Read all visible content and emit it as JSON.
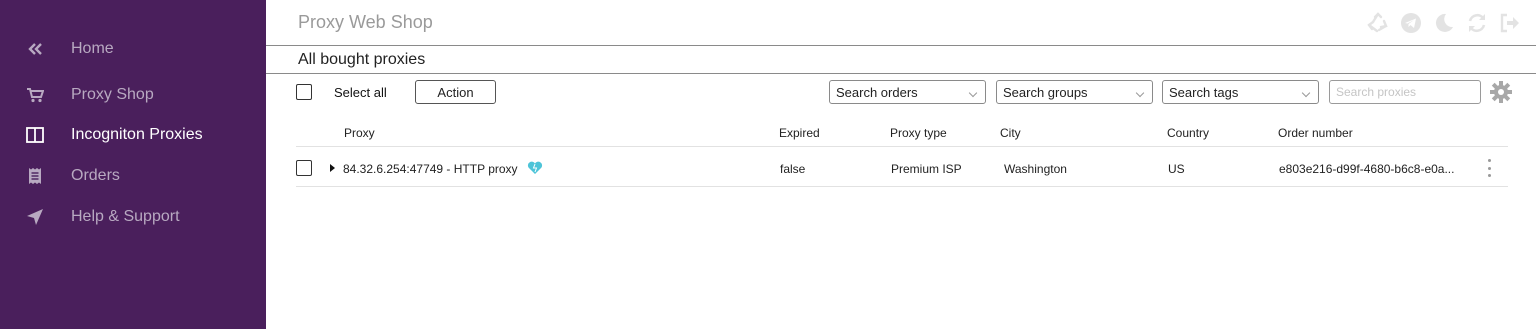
{
  "app": {
    "title": "Proxy Web Shop"
  },
  "sidebar": {
    "items": [
      {
        "label": "Home",
        "icon": "double-chevron-left-icon"
      },
      {
        "label": "Proxy Shop",
        "icon": "cart-icon"
      },
      {
        "label": "Incogniton Proxies",
        "icon": "columns-icon",
        "active": true
      },
      {
        "label": "Orders",
        "icon": "receipt-icon"
      },
      {
        "label": "Help & Support",
        "icon": "paper-plane-icon"
      }
    ]
  },
  "topbar": {
    "icons": [
      "recycle-icon",
      "telegram-icon",
      "moon-icon",
      "refresh-icon",
      "logout-icon"
    ]
  },
  "section": {
    "title": "All bought proxies"
  },
  "toolbar": {
    "select_all_label": "Select all",
    "action_label": "Action",
    "search_orders": "Search orders",
    "search_groups": "Search groups",
    "search_tags": "Search tags",
    "search_proxies_placeholder": "Search proxies"
  },
  "table": {
    "headers": {
      "proxy": "Proxy",
      "expired": "Expired",
      "proxy_type": "Proxy type",
      "city": "City",
      "country": "Country",
      "order_number": "Order number"
    },
    "rows": [
      {
        "proxy": "84.32.6.254:47749 - HTTP proxy",
        "expired": "false",
        "proxy_type": "Premium ISP",
        "city": "Washington",
        "country": "US",
        "order_number": "e803e216-d99f-4680-b6c8-e0a..."
      }
    ]
  },
  "colors": {
    "sidebar_bg": "#4a1f5c",
    "active_text": "#ffffff",
    "inactive_text": "#b8a9c1",
    "heart_accent": "#4dc4d8"
  }
}
